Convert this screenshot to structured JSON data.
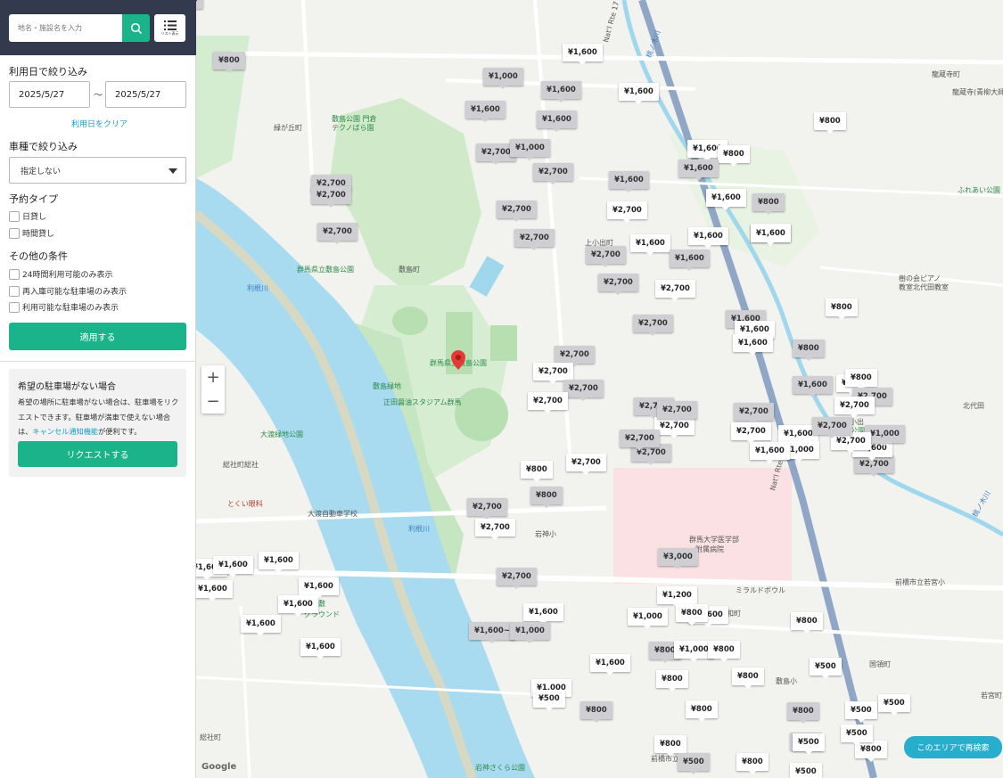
{
  "search": {
    "placeholder": "地名・施設名を入力",
    "list_label": "リスト表示"
  },
  "filter": {
    "date_title": "利用日で絞り込み",
    "date_from": "2025/5/27",
    "date_tilde": "～",
    "date_to": "2025/5/27",
    "date_clear": "利用日をクリア",
    "car_title": "車種で絞り込み",
    "car_value": "指定しない",
    "reserve_title": "予約タイプ",
    "reserve_options": [
      "日貸し",
      "時間貸し"
    ],
    "other_title": "その他の条件",
    "other_options": [
      "24時間利用可能のみ表示",
      "再入庫可能な駐車場のみ表示",
      "利用可能な駐車場のみ表示"
    ],
    "apply_label": "適用する"
  },
  "request": {
    "title": "希望の駐車場がない場合",
    "text_before": "希望の場所に駐車場がない場合は、駐車場をリクエストできます。駐車場が満車で使えない場合は、",
    "link": "キャンセル通知機能",
    "text_after": "が便利です。",
    "button_label": "リクエストする"
  },
  "map": {
    "research_label": "このエリアで再検索",
    "google_label": "Google",
    "places": [
      {
        "name": "緑が丘町",
        "kind": "area"
      },
      {
        "name": "敷島公園 門倉",
        "kind": "area"
      },
      {
        "name": "テクノばら園",
        "kind": "area"
      },
      {
        "name": "群馬県立敷島公園",
        "kind": "park"
      },
      {
        "name": "敷島町",
        "kind": "area"
      },
      {
        "name": "上小出町",
        "kind": "area"
      },
      {
        "name": "龍蔵寺町",
        "kind": "area"
      },
      {
        "name": "龍蔵寺(青柳大師)",
        "kind": "area"
      },
      {
        "name": "ふれあい公園",
        "kind": "park"
      },
      {
        "name": "樹の会ピアノ",
        "kind": "area"
      },
      {
        "name": "教室北代田教室",
        "kind": "area"
      },
      {
        "name": "群馬県立敷島公園",
        "kind": "park"
      },
      {
        "name": "敷島緑地",
        "kind": "park"
      },
      {
        "name": "正田醤油スタジアム群馬",
        "kind": "park"
      },
      {
        "name": "大渡緑地公園",
        "kind": "park"
      },
      {
        "name": "総社町総社",
        "kind": "area"
      },
      {
        "name": "とくい眼科",
        "kind": "area"
      },
      {
        "name": "大渡自動車学校",
        "kind": "area"
      },
      {
        "name": "利根川",
        "kind": "water"
      },
      {
        "name": "利根川",
        "kind": "water"
      },
      {
        "name": "岩神小",
        "kind": "area"
      },
      {
        "name": "群馬大学医学部",
        "kind": "area"
      },
      {
        "name": "附属病院",
        "kind": "area"
      },
      {
        "name": "北代田",
        "kind": "area"
      },
      {
        "name": "下小出",
        "kind": "area"
      },
      {
        "name": "中央公園",
        "kind": "park"
      },
      {
        "name": "前橋市立若宮小",
        "kind": "area"
      },
      {
        "name": "ミラルドボウル",
        "kind": "area"
      },
      {
        "name": "昭和町",
        "kind": "area"
      },
      {
        "name": "国領町",
        "kind": "area"
      },
      {
        "name": "敷島小",
        "kind": "area"
      },
      {
        "name": "若宮町",
        "kind": "area"
      },
      {
        "name": "総社町",
        "kind": "area"
      },
      {
        "name": "岩神さくら公園",
        "kind": "park"
      },
      {
        "name": "前橋市立",
        "kind": "area"
      },
      {
        "name": "河川敷",
        "kind": "park"
      },
      {
        "name": "グラウンド",
        "kind": "park"
      },
      {
        "name": "桃ノ木川",
        "kind": "water"
      },
      {
        "name": "桃ノ木川",
        "kind": "water"
      },
      {
        "name": "Nat'l Rte 17",
        "kind": "area"
      },
      {
        "name": "Nat'l Rte 17",
        "kind": "area"
      }
    ],
    "pins": [
      {
        "price": "¥800",
        "style": "g"
      },
      {
        "price": "¥1,600",
        "style": "w"
      },
      {
        "price": "¥1,000",
        "style": "g"
      },
      {
        "price": "¥1,600",
        "style": "g"
      },
      {
        "price": "¥1,600",
        "style": "w"
      },
      {
        "price": "¥1,600",
        "style": "g"
      },
      {
        "price": "¥1,600",
        "style": "g"
      },
      {
        "price": "¥800",
        "style": "w"
      },
      {
        "price": "¥2,700",
        "style": "g"
      },
      {
        "price": "¥1,000",
        "style": "g"
      },
      {
        "price": "¥1,600",
        "style": "w"
      },
      {
        "price": "¥800",
        "style": "w"
      },
      {
        "price": "¥1,600",
        "style": "g"
      },
      {
        "price": "¥2,700",
        "style": "g"
      },
      {
        "price": "¥1,600",
        "style": "g"
      },
      {
        "price": "¥2,700",
        "style": "g"
      },
      {
        "price": "¥1,600",
        "style": "w"
      },
      {
        "price": "¥800",
        "style": "g"
      },
      {
        "price": "¥2,700",
        "style": "g"
      },
      {
        "price": "¥2,700",
        "style": "g"
      },
      {
        "price": "¥1,600",
        "style": "w"
      },
      {
        "price": "¥1,600",
        "style": "w"
      },
      {
        "price": "¥1,600",
        "style": "w"
      },
      {
        "price": "¥2,700",
        "style": "g"
      },
      {
        "price": "¥2,700",
        "style": "w"
      },
      {
        "price": "¥2,700",
        "style": "g"
      },
      {
        "price": "¥1,600",
        "style": "g"
      },
      {
        "price": "¥2,700",
        "style": "g"
      },
      {
        "price": "¥2,700",
        "style": "g"
      },
      {
        "price": "¥2,700",
        "style": "w"
      },
      {
        "price": "¥800",
        "style": "w"
      },
      {
        "price": "¥1,600",
        "style": "g"
      },
      {
        "price": "¥2,700",
        "style": "g"
      },
      {
        "price": "¥1,600",
        "style": "w"
      },
      {
        "price": "¥1,600",
        "style": "w"
      },
      {
        "price": "¥800",
        "style": "g"
      },
      {
        "price": "¥2,700",
        "style": "g"
      },
      {
        "price": "¥2,700",
        "style": "w"
      },
      {
        "price": "¥2,700",
        "style": "g"
      },
      {
        "price": "¥2,700",
        "style": "w"
      },
      {
        "price": "¥2,700",
        "style": "g"
      },
      {
        "price": "¥2,700",
        "style": "w"
      },
      {
        "price": "¥2,700",
        "style": "g"
      },
      {
        "price": "¥2,700",
        "style": "w"
      },
      {
        "price": "¥800",
        "style": "w"
      },
      {
        "price": "¥800",
        "style": "g"
      },
      {
        "price": "¥2,700",
        "style": "g"
      },
      {
        "price": "¥2,700",
        "style": "w"
      },
      {
        "price": "¥2,700",
        "style": "g"
      },
      {
        "price": "¥3,000",
        "style": "g"
      },
      {
        "price": "¥2,700",
        "style": "g"
      },
      {
        "price": "¥2,700",
        "style": "w"
      },
      {
        "price": "¥1,600",
        "style": "w"
      },
      {
        "price": "¥2,700",
        "style": "g"
      },
      {
        "price": "¥1,600",
        "style": "w"
      },
      {
        "price": "¥1,600",
        "style": "g"
      },
      {
        "price": "¥800",
        "style": "w"
      },
      {
        "price": "¥1,000",
        "style": "w"
      },
      {
        "price": "¥800",
        "style": "w"
      },
      {
        "price": "¥2,700",
        "style": "g"
      },
      {
        "price": "¥2,700",
        "style": "w"
      },
      {
        "price": "¥1,000",
        "style": "g"
      },
      {
        "price": "¥1,600",
        "style": "w"
      },
      {
        "price": "¥2,700",
        "style": "g"
      },
      {
        "price": "¥2,700",
        "style": "g"
      },
      {
        "price": "¥2,700",
        "style": "w"
      },
      {
        "price": "¥2,700",
        "style": "g"
      },
      {
        "price": "¥1,600",
        "style": "w"
      },
      {
        "price": "¥1,600",
        "style": "w"
      },
      {
        "price": "¥1,600",
        "style": "w"
      },
      {
        "price": "¥1,600",
        "style": "w"
      },
      {
        "price": "¥1,600",
        "style": "w"
      },
      {
        "price": "¥1,600",
        "style": "w"
      },
      {
        "price": "¥1,600",
        "style": "w"
      },
      {
        "price": "¥1,600",
        "style": "w"
      },
      {
        "price": "¥1,600",
        "style": "w"
      },
      {
        "price": "¥1,200",
        "style": "w"
      },
      {
        "price": "¥1,600~",
        "style": "g"
      },
      {
        "price": "¥1,000",
        "style": "g"
      },
      {
        "price": "¥1,600",
        "style": "w"
      },
      {
        "price": "¥1,000",
        "style": "w"
      },
      {
        "price": "¥1,600",
        "style": "w"
      },
      {
        "price": "¥1,600",
        "style": "w"
      },
      {
        "price": "¥800",
        "style": "w"
      },
      {
        "price": "¥800",
        "style": "g"
      },
      {
        "price": "¥1,000",
        "style": "w"
      },
      {
        "price": "¥800",
        "style": "w"
      },
      {
        "price": "¥800",
        "style": "w"
      },
      {
        "price": "¥800",
        "style": "w"
      },
      {
        "price": "¥500",
        "style": "w"
      },
      {
        "price": "¥800",
        "style": "w"
      },
      {
        "price": "¥1,000",
        "style": "w"
      },
      {
        "price": "¥800",
        "style": "w"
      },
      {
        "price": "¥800",
        "style": "g"
      },
      {
        "price": "¥800",
        "style": "g"
      },
      {
        "price": "¥800",
        "style": "w"
      },
      {
        "price": "¥500",
        "style": "g"
      },
      {
        "price": "¥500",
        "style": "w"
      },
      {
        "price": "¥500",
        "style": "g"
      },
      {
        "price": "¥800",
        "style": "w"
      },
      {
        "price": "¥500",
        "style": "w"
      },
      {
        "price": "¥500",
        "style": "w"
      },
      {
        "price": "¥800",
        "style": "w"
      },
      {
        "price": "¥500",
        "style": "w"
      },
      {
        "price": "¥500",
        "style": "w"
      },
      {
        "price": "¥500",
        "style": "w"
      },
      {
        "price": "¥500",
        "style": "g"
      }
    ]
  }
}
